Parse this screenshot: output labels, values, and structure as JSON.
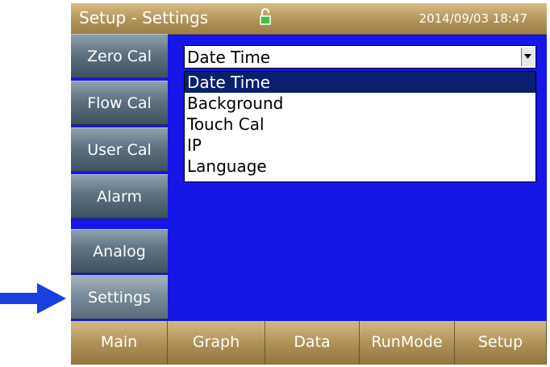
{
  "header": {
    "title": "Setup - Settings",
    "datetime": "2014/09/03 18:47",
    "lock_icon": "unlocked-padlock-icon"
  },
  "sidebar": {
    "items": [
      {
        "label": "Zero Cal"
      },
      {
        "label": "Flow Cal"
      },
      {
        "label": "User Cal"
      },
      {
        "label": "Alarm"
      },
      {
        "label": "Analog"
      },
      {
        "label": "Settings",
        "active": true
      }
    ]
  },
  "dropdown": {
    "selected": "Date Time",
    "options": [
      "Date Time",
      "Background",
      "Touch Cal",
      "IP",
      "Language"
    ]
  },
  "tabs": [
    {
      "label": "Main"
    },
    {
      "label": "Graph"
    },
    {
      "label": "Data"
    },
    {
      "label": "RunMode"
    },
    {
      "label": "Setup"
    }
  ],
  "colors": {
    "screen_bg": "#1616e6",
    "header_gold": "#b2945a",
    "highlight": "#0a1f6e",
    "pointer": "#1a3fe0"
  }
}
